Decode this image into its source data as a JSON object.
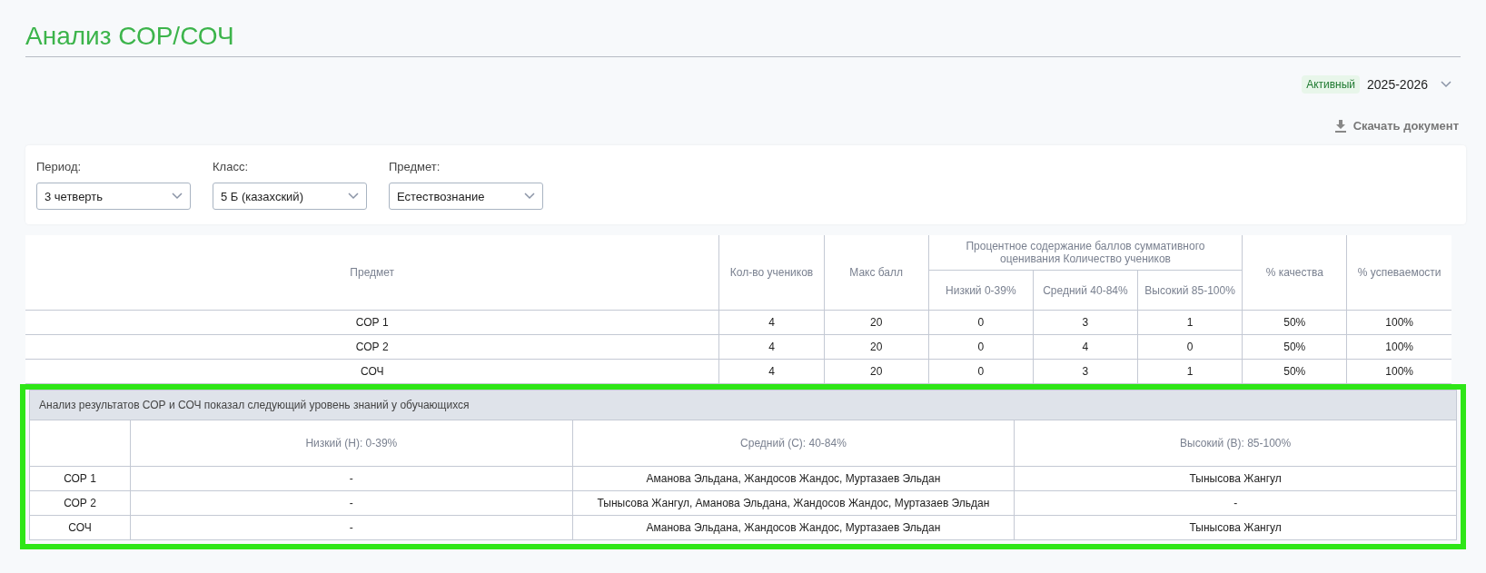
{
  "page": {
    "title": "Анализ СОР/СОЧ"
  },
  "year": {
    "badge": "Активный",
    "value": "2025-2026"
  },
  "download": {
    "label": "Скачать документ"
  },
  "filters": [
    {
      "label": "Период:",
      "value": "3 четверть"
    },
    {
      "label": "Класс:",
      "value": "5 Б (казахский)"
    },
    {
      "label": "Предмет:",
      "value": "Естествознание"
    }
  ],
  "summary_table": {
    "columns": {
      "subject": "Предмет",
      "students": "Кол-во учеников",
      "max": "Макс балл",
      "group": "Процентное содержание баллов суммативного оценивания Количество учеников",
      "low": "Низкий 0-39%",
      "mid": "Средний 40-84%",
      "high": "Высокий 85-100%",
      "quality": "% качества",
      "progress": "% успеваемости"
    },
    "rows": [
      {
        "subject": "СОР 1",
        "students": "4",
        "max": "20",
        "low": "0",
        "mid": "3",
        "high": "1",
        "quality": "50%",
        "progress": "100%"
      },
      {
        "subject": "СОР 2",
        "students": "4",
        "max": "20",
        "low": "0",
        "mid": "4",
        "high": "0",
        "quality": "50%",
        "progress": "100%"
      },
      {
        "subject": "СОЧ",
        "students": "4",
        "max": "20",
        "low": "0",
        "mid": "3",
        "high": "1",
        "quality": "50%",
        "progress": "100%"
      }
    ]
  },
  "analysis_table": {
    "highlighted": true,
    "caption": "Анализ результатов СОР и СОЧ показал следующий уровень знаний у обучающихся",
    "columns": [
      "Низкий (Н): 0-39%",
      "Средний (С): 40-84%",
      "Высокий (В): 85-100%"
    ],
    "rows": [
      {
        "label": "СОР 1",
        "cells": [
          "-",
          "Аманова Эльдана, Жандосов Жандос, Муртазаев Эльдан",
          "Тынысова Жангул"
        ]
      },
      {
        "label": "СОР 2",
        "cells": [
          "-",
          "Тынысова Жангул, Аманова Эльдана, Жандосов Жандос, Муртазаев Эльдан",
          "-"
        ]
      },
      {
        "label": "СОЧ",
        "cells": [
          "-",
          "Аманова Эльдана, Жандосов Жандос, Муртазаев Эльдан",
          "Тынысова Жангул"
        ]
      }
    ]
  }
}
